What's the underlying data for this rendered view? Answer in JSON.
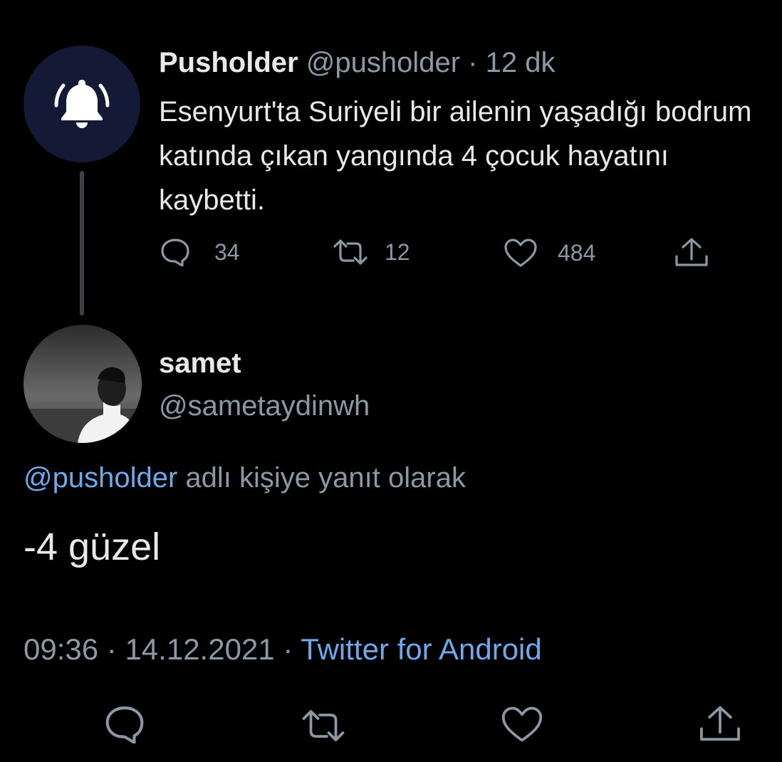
{
  "parent_tweet": {
    "display_name": "Pusholder",
    "handle": "@pusholder",
    "separator": "·",
    "time_ago": "12 dk",
    "text": "Esenyurt'ta Suriyeli bir ailenin yaşadığı bodrum katında çıkan yangında 4 çocuk hayatını kaybetti.",
    "avatar_icon": "bell-icon",
    "actions": {
      "replies": "34",
      "retweets": "12",
      "likes": "484"
    }
  },
  "reply_tweet": {
    "display_name": "samet",
    "handle": "@sametaydinwh",
    "reply_to_mention": "@pusholder",
    "reply_to_suffix": "adlı kişiye yanıt olarak",
    "text": "-4 güzel",
    "time": "09:36",
    "date": "14.12.2021",
    "separator": "·",
    "client": "Twitter for Android"
  },
  "bottom_actions": [
    "reply-icon",
    "retweet-icon",
    "like-icon",
    "share-icon"
  ],
  "colors": {
    "background": "#000000",
    "primary_text": "#e7e9ea",
    "secondary_text": "#8b98a5",
    "link": "#6ea9ec",
    "avatar_bg": "#141935"
  }
}
